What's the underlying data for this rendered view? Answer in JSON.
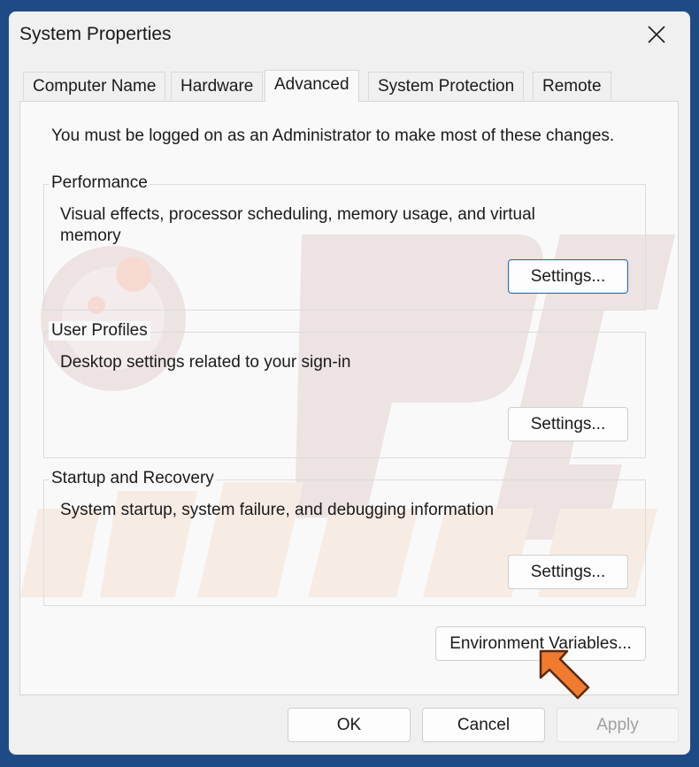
{
  "window": {
    "title": "System Properties"
  },
  "tabs": [
    {
      "label": "Computer Name"
    },
    {
      "label": "Hardware"
    },
    {
      "label": "Advanced",
      "active": true
    },
    {
      "label": "System Protection"
    },
    {
      "label": "Remote"
    }
  ],
  "advanced": {
    "admin_note": "You must be logged on as an Administrator to make most of these changes.",
    "performance": {
      "label": "Performance",
      "description": "Visual effects, processor scheduling, memory usage, and virtual memory",
      "button": "Settings..."
    },
    "user_profiles": {
      "label": "User Profiles",
      "description": "Desktop settings related to your sign-in",
      "button": "Settings..."
    },
    "startup_recovery": {
      "label": "Startup and Recovery",
      "description": "System startup, system failure, and debugging information",
      "button": "Settings..."
    },
    "environment_button": "Environment Variables..."
  },
  "footer": {
    "ok": "OK",
    "cancel": "Cancel",
    "apply": "Apply",
    "apply_disabled": true
  },
  "icons": {
    "close": "close-icon",
    "annotation": "orange-arrow-icon"
  },
  "colors": {
    "arrow": "#f07b2e",
    "focus_border": "#2a6ebd",
    "watermark": "#e8dedd"
  }
}
